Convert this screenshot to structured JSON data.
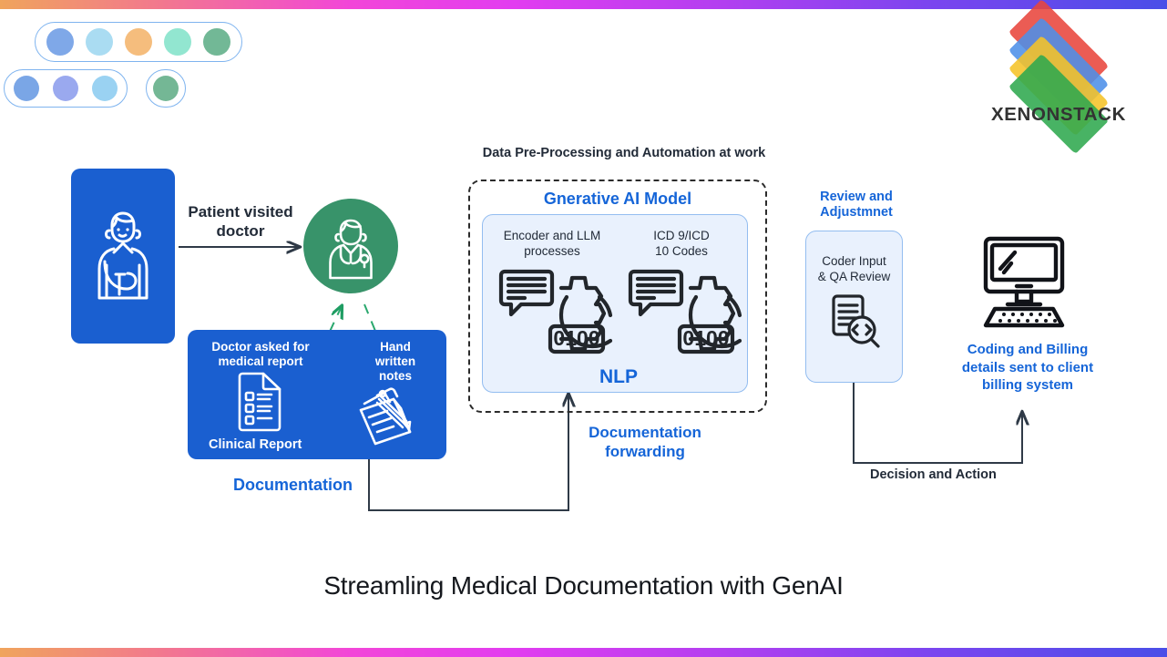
{
  "meta": {
    "page_title": "Streamling Medical Documentation with GenAI"
  },
  "brand": {
    "name": "XENONSTACK",
    "logo_layers": [
      {
        "name": "red-layer",
        "color": "#e8453c"
      },
      {
        "name": "blue-layer",
        "color": "#4d90e8"
      },
      {
        "name": "yellow-layer",
        "color": "#f5c328"
      },
      {
        "name": "green-layer",
        "color": "#2fa84f"
      }
    ]
  },
  "decor": {
    "pill_one_dots": [
      "#7fa8e8",
      "#aadcf2",
      "#f5bd7d",
      "#92e6d0",
      "#72b896"
    ],
    "pill_two_dots": [
      "#7aa6e6",
      "#9aa9ef",
      "#9ad2f2"
    ],
    "pill_three_dots": [
      "#74b795"
    ]
  },
  "diagram": {
    "patient": {
      "icon": "patient-arm-sling-icon",
      "card_color": "#1a5fd0"
    },
    "arrow_patient_to_doctor": {
      "label": "Patient visited\ndoctor",
      "label_line1": "Patient visited",
      "label_line2": "doctor"
    },
    "doctor": {
      "icon": "doctor-stethoscope-icon",
      "circle_color": "#38936a"
    },
    "documentation_card": {
      "caption": "Documentation",
      "left_label_line1": "Doctor asked for",
      "left_label_line2": "medical report",
      "left_icon": "clinical-report-document-icon",
      "left_icon_caption": "Clinical Report",
      "right_label_line1": "Hand",
      "right_label_line2": "written",
      "right_label_line3": "notes",
      "right_icon": "handwritten-notes-pen-icon"
    },
    "preprocessing": {
      "heading": "Data Pre-Processing and Automation at work",
      "model_title": "Gnerative AI Model",
      "nlp_label": "NLP",
      "blocks": [
        {
          "label_line1": "Encoder and LLM",
          "label_line2": "processes",
          "icon": "gear-binary-chat-icon",
          "badge": "0100"
        },
        {
          "label_line1": "ICD 9/ICD",
          "label_line2": "10 Codes",
          "icon": "gear-binary-chat-icon",
          "badge": "0100"
        }
      ]
    },
    "documentation_forwarding": {
      "label_line1": "Documentation",
      "label_line2": "forwarding"
    },
    "review": {
      "title_line1": "Review and",
      "title_line2": "Adjustmnet",
      "card_label_line1": "Coder Input",
      "card_label_line2": "& QA Review",
      "icon": "code-review-magnifier-icon"
    },
    "decision_action": {
      "label": "Decision and Action"
    },
    "billing": {
      "icon": "desktop-monitor-keyboard-icon",
      "label_line1": "Coding and Billing",
      "label_line2": "details sent to client",
      "label_line3": "billing system"
    }
  },
  "colors": {
    "brand_blue": "#1a5fd0",
    "accent_blue_text": "#1565d8",
    "green": "#38936a",
    "dark": "#222b38",
    "light_blue_panel": "#e9f1fd"
  }
}
